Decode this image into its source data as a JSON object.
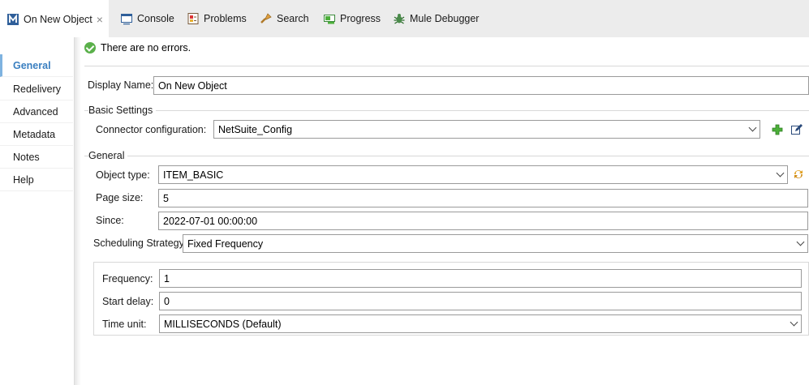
{
  "tabs": [
    {
      "label": "On New Object",
      "icon": "flow-icon",
      "active": true
    },
    {
      "label": "Console",
      "icon": "console-icon"
    },
    {
      "label": "Problems",
      "icon": "problems-icon"
    },
    {
      "label": "Search",
      "icon": "search-icon"
    },
    {
      "label": "Progress",
      "icon": "progress-icon"
    },
    {
      "label": "Mule Debugger",
      "icon": "bug-icon"
    }
  ],
  "tab_close": "×",
  "sidebar": {
    "items": [
      {
        "label": "General",
        "active": true
      },
      {
        "label": "Redelivery"
      },
      {
        "label": "Advanced"
      },
      {
        "label": "Metadata"
      },
      {
        "label": "Notes"
      },
      {
        "label": "Help"
      }
    ]
  },
  "status": {
    "text": "There are no errors."
  },
  "display_name": {
    "label": "Display Name:",
    "value": "On New Object"
  },
  "basic_settings": {
    "title": "Basic Settings",
    "connector_label": "Connector configuration:",
    "connector_value": "NetSuite_Config"
  },
  "general": {
    "title": "General",
    "object_type_label": "Object type:",
    "object_type_value": "ITEM_BASIC",
    "page_size_label": "Page size:",
    "page_size_value": "5",
    "since_label": "Since:",
    "since_value": "2022-07-01 00:00:00",
    "scheduling_label": "Scheduling Strategy",
    "scheduling_value": "Fixed Frequency"
  },
  "schedule": {
    "frequency_label": "Frequency:",
    "frequency_value": "1",
    "start_delay_label": "Start delay:",
    "start_delay_value": "0",
    "time_unit_label": "Time unit:",
    "time_unit_value": "MILLISECONDS (Default)"
  },
  "colors": {
    "accent": "#3a7fc0",
    "ok": "#5ab04a",
    "add": "#4caf3a"
  }
}
